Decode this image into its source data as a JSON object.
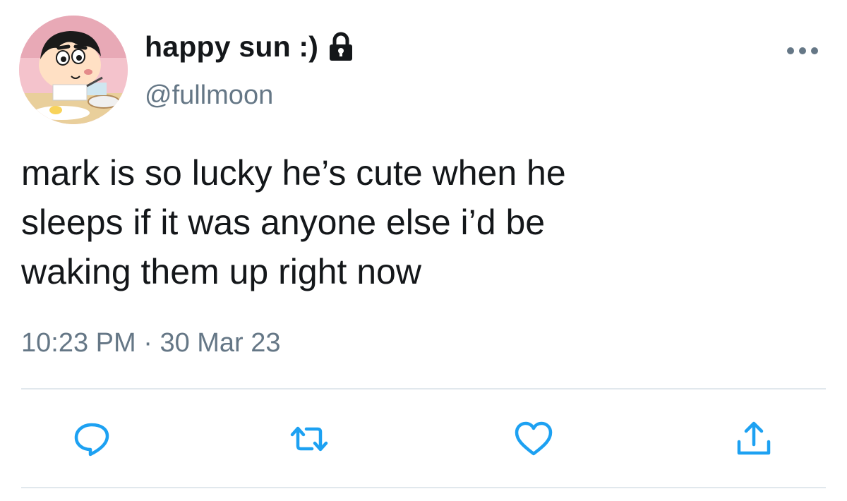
{
  "user": {
    "display_name": "happy sun :)",
    "handle": "@fullmoon",
    "protected": true
  },
  "tweet": {
    "text": "mark is so lucky he’s cute when he\nsleeps if it was anyone else i’d be\nwaking them up right now",
    "time": "10:23 PM",
    "separator": "·",
    "date": "30 Mar 23"
  },
  "icons": {
    "lock": "lock-icon",
    "more": "more-dots-icon",
    "reply": "reply-icon",
    "retweet": "retweet-icon",
    "like": "heart-icon",
    "share": "share-icon"
  },
  "colors": {
    "text": "#14171a",
    "secondary": "#657786",
    "action": "#1da1f2",
    "divider": "#e1e8ed"
  }
}
